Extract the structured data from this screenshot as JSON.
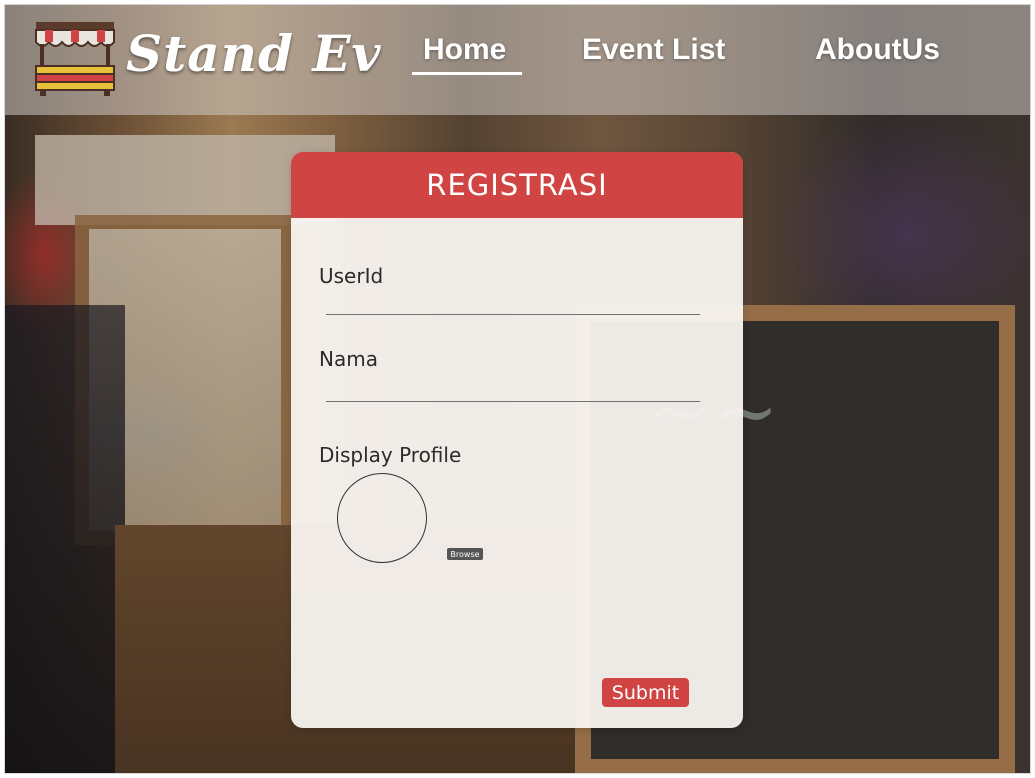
{
  "header": {
    "brand": "Stand Ev",
    "nav": {
      "home": "Home",
      "event_list": "Event List",
      "about_us": "AboutUs"
    },
    "active_nav": "home"
  },
  "registration": {
    "title": "REGISTRASI",
    "fields": {
      "userid_label": "UserId",
      "userid_value": "",
      "nama_label": "Nama",
      "nama_value": "",
      "display_profile_label": "Display Profile"
    },
    "browse_label": "Browse",
    "submit_label": "Submit"
  },
  "colors": {
    "accent": "#d04544",
    "card_bg": "#f8f4f0",
    "nav_text": "#ffffff"
  },
  "icons": {
    "logo": "market-stand-icon",
    "avatar": "profile-placeholder-circle"
  }
}
